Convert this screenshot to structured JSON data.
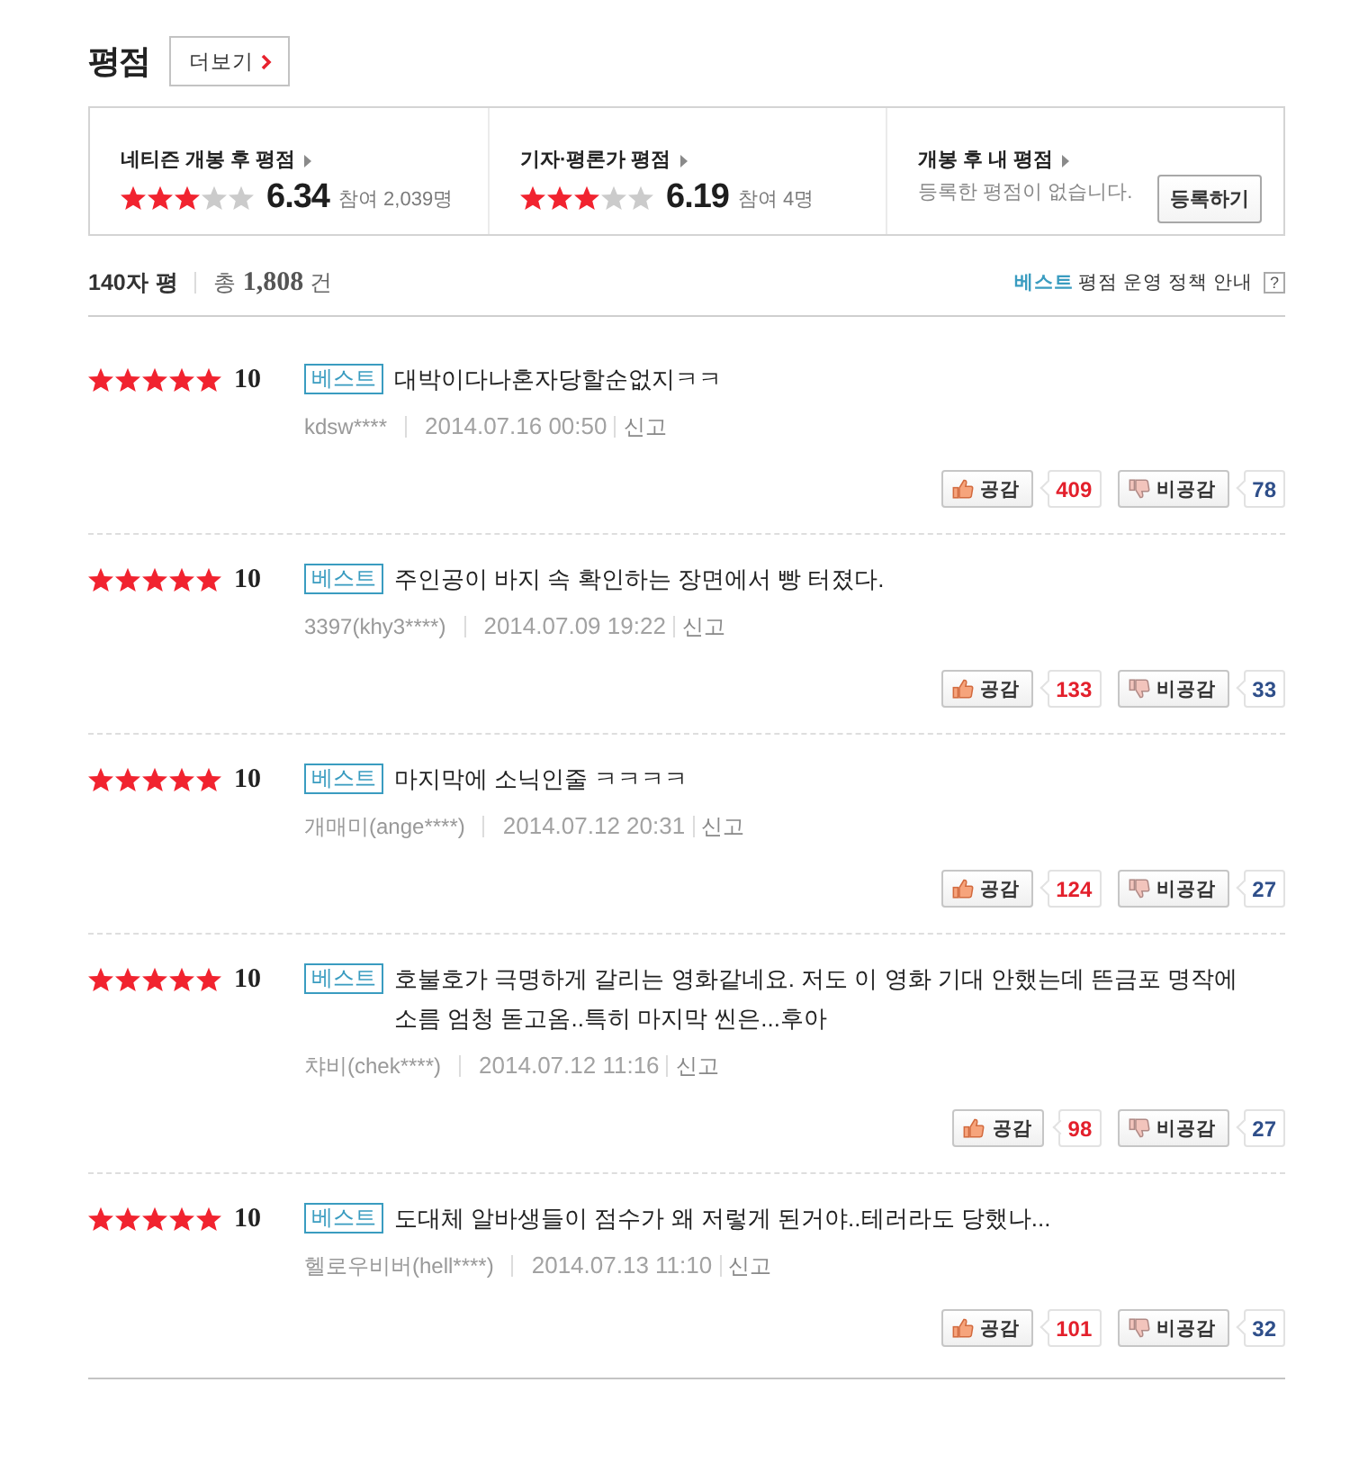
{
  "section": {
    "title": "평점",
    "more_button": "더보기"
  },
  "summary": [
    {
      "kind": "rating",
      "title": "네티즌 개봉 후 평점",
      "stars": 3,
      "score": "6.34",
      "participants": "참여 2,039명"
    },
    {
      "kind": "rating",
      "title": "기자·평론가 평점",
      "stars": 3,
      "score": "6.19",
      "participants": "참여 4명"
    },
    {
      "kind": "mine",
      "title": "개봉 후 내 평점",
      "message": "등록한 평점이 없습니다.",
      "button": "등록하기"
    }
  ],
  "list_header": {
    "title": "140자 평",
    "total": "총 **1,808** 건",
    "policy": "**베스트** 평점 운영 정책 안내",
    "help": "?"
  },
  "reviews": [
    {
      "stars": 5,
      "score": "10",
      "badge": "베스트",
      "text": "대박이다나혼자당할순없지ㅋㅋ",
      "author": "kdsw****",
      "date": "2014.07.16 00:50",
      "report": "신고",
      "like_label": "공감",
      "likes": "409",
      "dislike_label": "비공감",
      "dislikes": "78"
    },
    {
      "stars": 5,
      "score": "10",
      "badge": "베스트",
      "text": "주인공이 바지 속 확인하는 장면에서 빵 터졌다.",
      "author": "3397(khy3****)",
      "date": "2014.07.09 19:22",
      "report": "신고",
      "like_label": "공감",
      "likes": "133",
      "dislike_label": "비공감",
      "dislikes": "33"
    },
    {
      "stars": 5,
      "score": "10",
      "badge": "베스트",
      "text": "마지막에 소닉인줄 ㅋㅋㅋㅋ",
      "author": "개매미(ange****)",
      "date": "2014.07.12 20:31",
      "report": "신고",
      "like_label": "공감",
      "likes": "124",
      "dislike_label": "비공감",
      "dislikes": "27"
    },
    {
      "stars": 5,
      "score": "10",
      "badge": "베스트",
      "text": "호불호가 극명하게 갈리는 영화같네요. 저도 이 영화 기대 안했는데 뜬금포 명작에 소름 엄청 돋고옴..특히 마지막 씬은...후아",
      "author": "챠비(chek****)",
      "date": "2014.07.12 11:16",
      "report": "신고",
      "like_label": "공감",
      "likes": "98",
      "dislike_label": "비공감",
      "dislikes": "27"
    },
    {
      "stars": 5,
      "score": "10",
      "badge": "베스트",
      "text": "도대체 알바생들이 점수가 왜 저렇게 된거야..테러라도 당했나...",
      "author": "헬로우비버(hell****)",
      "date": "2014.07.13 11:10",
      "report": "신고",
      "like_label": "공감",
      "likes": "101",
      "dislike_label": "비공감",
      "dislikes": "32"
    }
  ]
}
